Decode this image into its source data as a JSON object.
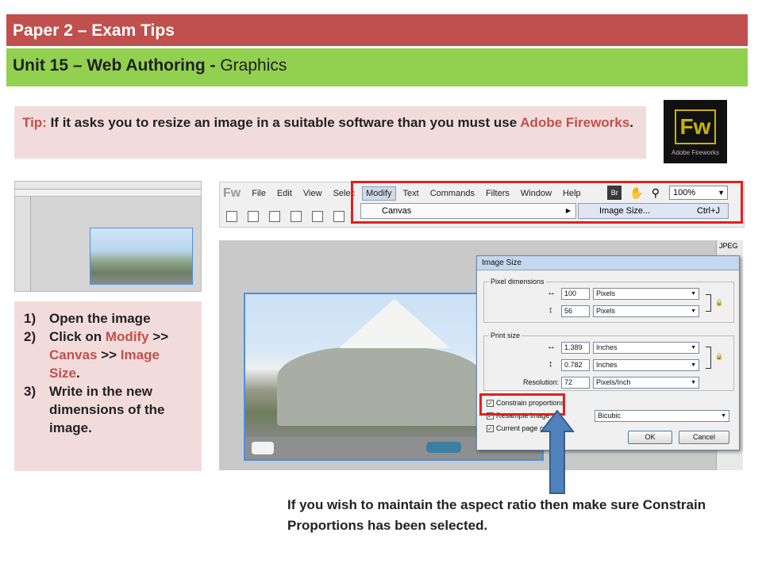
{
  "header": {
    "title": "Paper 2 – Exam Tips",
    "unit_bold": "Unit 15 – Web Authoring -",
    "unit_normal": " Graphics"
  },
  "tip": {
    "label": "Tip:",
    "text": " If it asks you to resize an image in a suitable software than you must use ",
    "software": "Adobe Fireworks",
    "end": "."
  },
  "logo": {
    "mark": "Fw",
    "caption": "Adobe Fireworks"
  },
  "steps": [
    {
      "num": "1)",
      "parts": [
        {
          "t": "Open the image",
          "red": false
        }
      ]
    },
    {
      "num": "2)",
      "parts": [
        {
          "t": "Click on ",
          "red": false
        },
        {
          "t": "Modify",
          "red": true
        },
        {
          "t": " >> ",
          "red": false
        },
        {
          "t": "Canvas",
          "red": true
        },
        {
          "t": " >> ",
          "red": false
        },
        {
          "t": "Image Size",
          "red": true
        },
        {
          "t": ".",
          "red": false
        }
      ]
    },
    {
      "num": "3)",
      "parts": [
        {
          "t": "Write in the new dimensions of the image.",
          "red": false
        }
      ]
    }
  ],
  "menubar": {
    "logo": "Fw",
    "items": [
      "File",
      "Edit",
      "View",
      "Selec",
      "Modify",
      "Text",
      "Commands",
      "Filters",
      "Window",
      "Help"
    ],
    "active": "Modify",
    "bridge": "Br",
    "zoom": "100%",
    "submenu_item": "Canvas",
    "subsubmenu_item": "Image Size...",
    "shortcut": "Ctrl+J"
  },
  "side_label": "JPEG",
  "dialog": {
    "title": "Image Size",
    "pixel_group": "Pixel dimensions",
    "width_px": "100",
    "height_px": "56",
    "pixel_unit": "Pixels",
    "print_group": "Print size",
    "width_in": "1.389",
    "height_in": "0.782",
    "print_unit": "Inches",
    "resolution_label": "Resolution:",
    "resolution": "72",
    "resolution_unit": "Pixels/Inch",
    "constrain": "Constrain proportions",
    "resample": "Resample image",
    "resample_method": "Bicubic",
    "current_page": "Current page only",
    "ok": "OK",
    "cancel": "Cancel"
  },
  "caption": "If you wish to maintain the aspect ratio then make sure Constrain Proportions has been selected."
}
